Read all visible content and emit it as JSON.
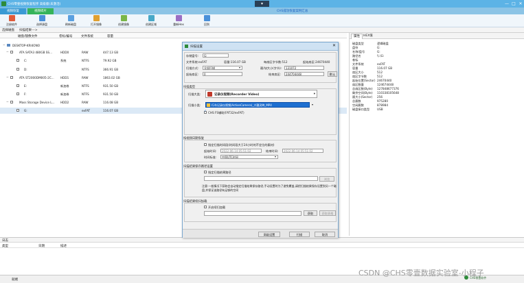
{
  "titlebar": {
    "title": "CHS零壹视频恢复程序 高级版(未激活)",
    "link": "CHS成功恢复案例汇总",
    "center_btn": "▾",
    "min": "—",
    "max": "□",
    "close": "✕"
  },
  "tabs": [
    "视频恢复",
    "视频碎片"
  ],
  "toolbar": [
    {
      "label": "注册软件",
      "color": "#e05b3a"
    },
    {
      "label": "选择源盘",
      "color": "#4a90d9"
    },
    {
      "label": "刷新磁盘",
      "color": "#5aa0e0"
    },
    {
      "label": "打开镜像",
      "color": "#e0a030"
    },
    {
      "label": "创建镜像",
      "color": "#7ab648"
    },
    {
      "label": "创建区域",
      "color": "#48a8c8"
    },
    {
      "label": "重新Hex",
      "color": "#9a6fc4"
    },
    {
      "label": "回到",
      "color": "#4a90d9"
    }
  ],
  "subbar": {
    "a": "选择磁盘",
    "b": "扫描结果--->"
  },
  "left_headers": {
    "name": "磁盘/镜像文件",
    "serial": "卷标/编号",
    "fs": "文件系统",
    "cap": "容量"
  },
  "tree": [
    {
      "name": "DESKTOP-KRI4ONO",
      "serial": "",
      "fs": "",
      "cap": ""
    },
    {
      "name": "ATA   SATA3 480GB SS...",
      "serial": "HDD0",
      "fs": "RAW",
      "cap": "447.13 GB"
    },
    {
      "name": "C:",
      "serial": "系统",
      "fs": "NTFS",
      "cap": "79.92 GB"
    },
    {
      "name": "D:",
      "serial": "",
      "fs": "NTFS",
      "cap": "366.91 GB"
    },
    {
      "name": "ATA   ST2000DM005-2C...",
      "serial": "HDD1",
      "fs": "RAW",
      "cap": "1863.02 GB"
    },
    {
      "name": "E:",
      "serial": "新加卷",
      "fs": "NTFS",
      "cap": "931.50 GB"
    },
    {
      "name": "F:",
      "serial": "新加卷",
      "fs": "NTFS",
      "cap": "931.50 GB"
    },
    {
      "name": "Mass   Storage Device  L...",
      "serial": "HDD2",
      "fs": "RAW",
      "cap": "116.08 GB"
    },
    {
      "name": "G:",
      "serial": "",
      "fs": "exFAT",
      "cap": "116.07 GB"
    }
  ],
  "right_tabs": [
    "属性",
    "HEX值"
  ],
  "props": [
    [
      "磁盘类型",
      "逻辑磁盘"
    ],
    [
      "盘符",
      "G:"
    ],
    [
      "名称/盘号",
      "G:"
    ],
    [
      "路径名",
      "\\\\.\\G:"
    ],
    [
      "卷标",
      ""
    ],
    [
      "文件系统",
      "exFAT"
    ],
    [
      "容量",
      "116.07 GB"
    ],
    [
      "扇区大小",
      "512"
    ],
    [
      "扇区字节数",
      "512"
    ],
    [
      "起始位置(Sector)",
      "24670440"
    ],
    [
      "扇区数量",
      "124674448"
    ],
    [
      "总扇区数(Byte)",
      "127848677376"
    ],
    [
      "剩余空间(Byte)",
      "110338105648"
    ],
    [
      "簇大小(Sector)",
      "256"
    ],
    [
      "总簇数",
      "975280"
    ],
    [
      "空闲簇数",
      "878984"
    ],
    [
      "磁盘接口类型",
      "USB"
    ]
  ],
  "dialog": {
    "title": "扫描设置",
    "close": "✕",
    "store_label": "存储盘号:",
    "store_val": "G:",
    "fs_label": "文件系统:exFAT",
    "cap_label": "容量:116.07 GB",
    "bps_label": "每扇区字节数:512",
    "start_label": "起始扇区:24670440",
    "mode_label": "扫描方式:",
    "mode_val": "全部扫描",
    "blocksize_label": "簇/块大小(字节):",
    "blocksize_val": "131072",
    "startsector_label": "起始扇区:",
    "startsector_val": "0",
    "endsector_label": "结束扇区:",
    "endsector_val": "244704448",
    "default_btn": "默认",
    "scan_type_section": "扫描类型",
    "scan_source_label": "扫描大类:",
    "scan_source_val": "记录仪视频(Recorder Video)",
    "scan_kind_label": "扫描小类:",
    "scan_kind_val": "行车记录仪视频(ActionCamera)_大疆灵眸_MP4",
    "fat_check": "CHS FS辅助(FAT32/exFAT)",
    "time_section": "按视频日期恢复",
    "time_check": "指定扫描时间段(时间段大于24小时的不定位的素材)",
    "t_start_label": "起始时间:",
    "t_start_val": "2022-06-14 05:51:02",
    "t_end_label": "结束时间:",
    "t_end_val": "2022-06-14 05:51:02",
    "tz_label": "时间标准:",
    "tz_val": "中国UTC时间",
    "path_section": "扫描结果保存路径设置",
    "path_check": "指定扫描结果路径",
    "browse_btn": "浏览",
    "note": "注意:一般情况下获取会自动指定扫描结果保存路径,手动设置时为了避免覆盖,请把扫描结果保存设置到另一个磁盘,并保证该路径有足够的空间",
    "resume_section": "扫描结果续扫加载",
    "resume_check": "开启续扫加载",
    "load_btn": "获取",
    "read_btn": "获取表格",
    "foot_adv": "高级设置",
    "foot_scan": "扫描",
    "foot_cancel": "取消"
  },
  "log": {
    "title": "日志",
    "c1": "类型",
    "c2": "日期",
    "c3": "描述"
  },
  "status": {
    "text": "就绪",
    "logo": "CHS零壹软件",
    "watermark": "CSDN @CHS零壹数据实验室-小程子"
  }
}
